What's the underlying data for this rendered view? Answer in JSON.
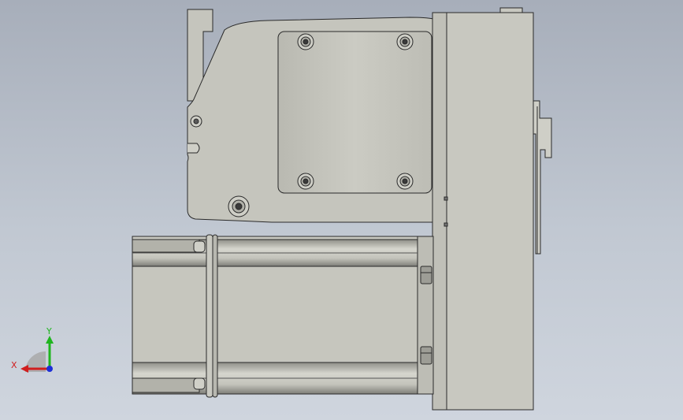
{
  "viewport": {
    "background_top": "#a7aeba",
    "background_bottom": "#cfd5de"
  },
  "model": {
    "body_color": "#c5c5bd",
    "edge_color": "#2a2a2a",
    "shadow_color": "#6e6e69"
  },
  "triad": {
    "x_label": "X",
    "y_label": "Y",
    "x_color": "#d01e1e",
    "y_color": "#1fb51f",
    "z_color": "#1d2fd6"
  }
}
